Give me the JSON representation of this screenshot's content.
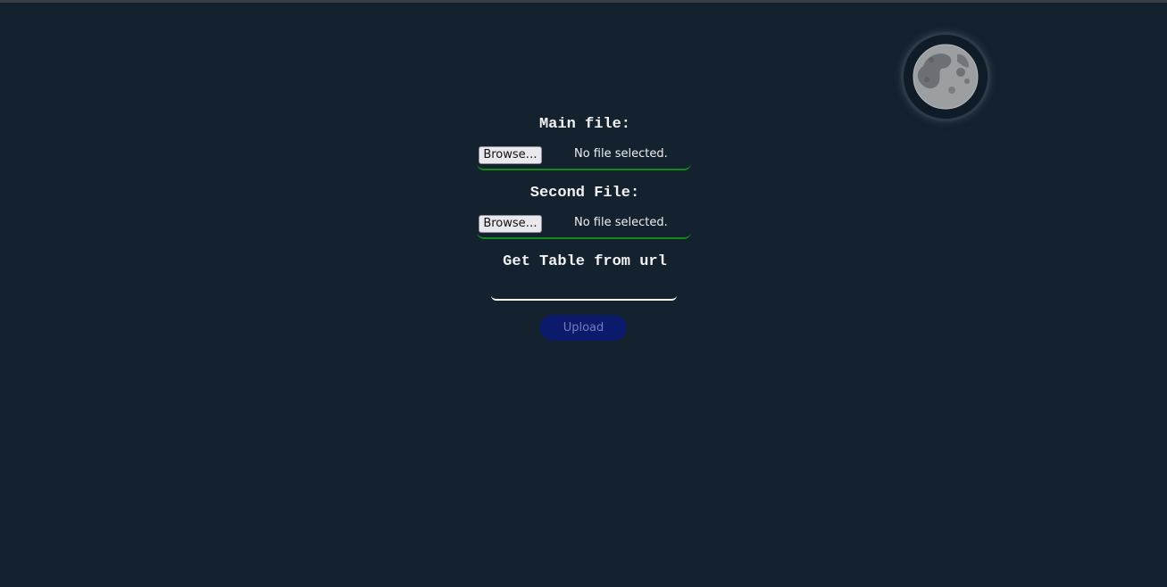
{
  "theme_toggle": {
    "icon": "moon-icon"
  },
  "form": {
    "main_file": {
      "label": "Main file:",
      "browse_label": "Browse…",
      "status": "No file selected."
    },
    "second_file": {
      "label": "Second File:",
      "browse_label": "Browse…",
      "status": "No file selected."
    },
    "url": {
      "label": "Get Table from url",
      "value": "",
      "placeholder": ""
    },
    "upload_label": "Upload"
  },
  "colors": {
    "background": "#14212e",
    "file_underline": "#138a17",
    "upload_button": "#0c1a6b",
    "upload_text": "#6f7fbf"
  }
}
